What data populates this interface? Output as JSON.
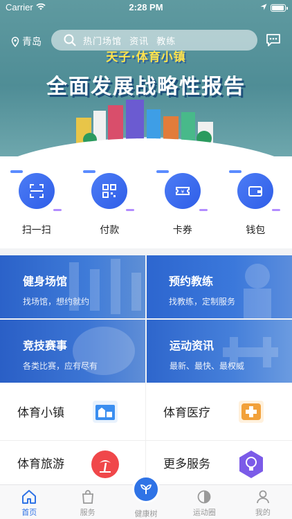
{
  "status_bar": {
    "carrier": "Carrier",
    "time": "2:28 PM"
  },
  "header": {
    "location": "青岛",
    "search_placeholder": "热门场馆  资讯  教练"
  },
  "banner": {
    "subtitle": "天子·体育小镇",
    "title": "全面发展战略性报告",
    "slide_count": 3,
    "active_slide": 2
  },
  "quick_actions": [
    {
      "label": "扫一扫",
      "icon": "scan-icon"
    },
    {
      "label": "付款",
      "icon": "qrcode-icon"
    },
    {
      "label": "卡券",
      "icon": "ticket-icon"
    },
    {
      "label": "钱包",
      "icon": "wallet-icon"
    }
  ],
  "service_cards": [
    {
      "title": "健身场馆",
      "subtitle": "找场馆，想约就约"
    },
    {
      "title": "预约教练",
      "subtitle": "找教练，定制服务"
    },
    {
      "title": "竞技赛事",
      "subtitle": "各类比赛，应有尽有"
    },
    {
      "title": "运动资讯",
      "subtitle": "最新、最快、最权威"
    }
  ],
  "feature_list": [
    {
      "title": "体育小镇",
      "icon": "town-icon",
      "color": "#3a8ef0"
    },
    {
      "title": "体育医疗",
      "icon": "medical-cross-icon",
      "color": "#f2a13a"
    },
    {
      "title": "体育旅游",
      "icon": "palm-tree-icon",
      "color": "#f0474a"
    },
    {
      "title": "更多服务",
      "icon": "lightbulb-icon",
      "color": "#7b5be8"
    }
  ],
  "tab_bar": [
    {
      "label": "首页",
      "active": true
    },
    {
      "label": "服务",
      "active": false
    },
    {
      "label": "健康树",
      "active": false
    },
    {
      "label": "运动圈",
      "active": false
    },
    {
      "label": "我的",
      "active": false
    }
  ],
  "colors": {
    "accent": "#2f73e6",
    "hero": "#4f8d96",
    "card": "#2f6ad0"
  }
}
